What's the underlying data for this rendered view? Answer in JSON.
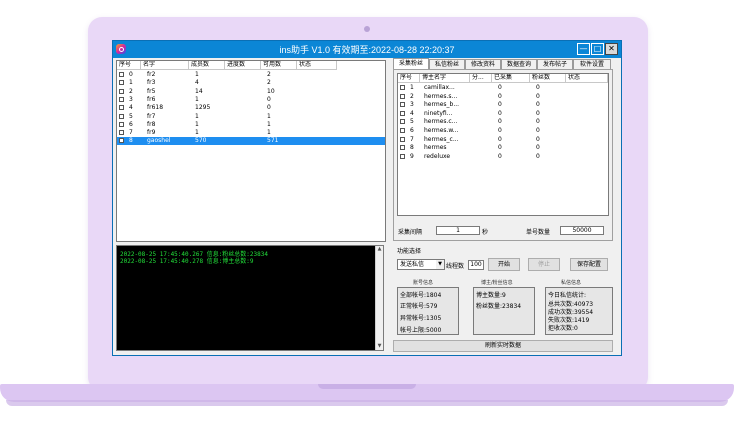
{
  "window": {
    "title": "ins助手 V1.0 有效期至:2022-08-28 22:20:37",
    "min_glyph": "—",
    "max_glyph": "□",
    "close_glyph": "✕"
  },
  "accounts": {
    "headers": [
      "序号",
      "名字",
      "成员数",
      "进度数",
      "可用数",
      "状态"
    ],
    "rows": [
      {
        "idx": "0",
        "name": "fr2",
        "members": "1",
        "progress": "",
        "available": "2",
        "status": ""
      },
      {
        "idx": "1",
        "name": "fr3",
        "members": "4",
        "progress": "",
        "available": "2",
        "status": ""
      },
      {
        "idx": "2",
        "name": "fr5",
        "members": "14",
        "progress": "",
        "available": "10",
        "status": ""
      },
      {
        "idx": "3",
        "name": "fr6",
        "members": "1",
        "progress": "",
        "available": "0",
        "status": ""
      },
      {
        "idx": "4",
        "name": "fr618",
        "members": "1295",
        "progress": "",
        "available": "0",
        "status": ""
      },
      {
        "idx": "5",
        "name": "fr7",
        "members": "1",
        "progress": "",
        "available": "1",
        "status": ""
      },
      {
        "idx": "6",
        "name": "fr8",
        "members": "1",
        "progress": "",
        "available": "1",
        "status": ""
      },
      {
        "idx": "7",
        "name": "fr9",
        "members": "1",
        "progress": "",
        "available": "1",
        "status": ""
      },
      {
        "idx": "8",
        "name": "gaoshel",
        "members": "570",
        "progress": "",
        "available": "571",
        "status": ""
      }
    ],
    "selected_index": 8
  },
  "log": {
    "lines": [
      "2022-08-25 17:45:40.267 信息:粉丝总数:23834",
      "2022-08-25 17:45:40.278 信息:博主总数:9"
    ]
  },
  "tabs": [
    "采集粉丝",
    "私信粉丝",
    "修改资料",
    "数据查询",
    "发布帖子",
    "软件设置"
  ],
  "active_tab": 0,
  "bloggers": {
    "headers": [
      "序号",
      "博主名字",
      "分...",
      "已采集",
      "粉丝数",
      "状态"
    ],
    "rows": [
      {
        "idx": "1",
        "name": "camillax...",
        "c1": "",
        "collected": "0",
        "fans": "0"
      },
      {
        "idx": "2",
        "name": "hermes.s...",
        "c1": "",
        "collected": "0",
        "fans": "0"
      },
      {
        "idx": "3",
        "name": "hermes_b...",
        "c1": "",
        "collected": "0",
        "fans": "0"
      },
      {
        "idx": "4",
        "name": "ninetyfi...",
        "c1": "",
        "collected": "0",
        "fans": "0"
      },
      {
        "idx": "5",
        "name": "hermes.c...",
        "c1": "",
        "collected": "0",
        "fans": "0"
      },
      {
        "idx": "6",
        "name": "hermes.w...",
        "c1": "",
        "collected": "0",
        "fans": "0"
      },
      {
        "idx": "7",
        "name": "hermes_c...",
        "c1": "",
        "collected": "0",
        "fans": "0"
      },
      {
        "idx": "8",
        "name": "hermes",
        "c1": "",
        "collected": "0",
        "fans": "0"
      },
      {
        "idx": "9",
        "name": "redeluxe",
        "c1": "",
        "collected": "0",
        "fans": "0"
      }
    ]
  },
  "collect": {
    "interval_label": "采集间隔",
    "interval_value": "1",
    "interval_unit": "秒",
    "single_count_label": "单号数量",
    "single_count_value": "50000"
  },
  "function": {
    "label": "功能选择",
    "mode": "发送私信",
    "threads_label": "线程数",
    "threads_value": "100",
    "start": "开始",
    "stop": "停止",
    "save": "保存配置"
  },
  "stats": {
    "account_title": "账号信息",
    "account_lines": [
      "全部帐号:1804",
      "正常帐号:579",
      "异常帐号:1305",
      "帐号上限:5000"
    ],
    "blogger_title": "博主/粉丝信息",
    "blogger_lines": [
      "博主数量:9",
      "粉丝数量:23834"
    ],
    "dm_title": "私信信息",
    "dm_lines": [
      "今日私信统计:",
      "总共次数:40973",
      "成功次数:39554",
      "失败次数:1419",
      "拒收次数:0"
    ]
  },
  "refresh_button": "刷新实时数据"
}
